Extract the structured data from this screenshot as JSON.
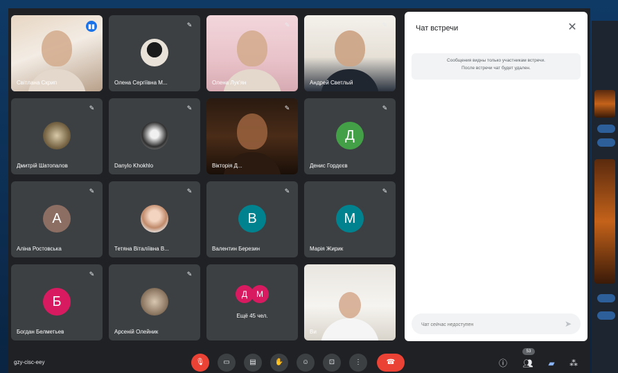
{
  "meeting": {
    "code": "gzy-cisc-eey",
    "participants_badge": "53"
  },
  "tiles": [
    {
      "name": "Світлана Скрип",
      "type": "video",
      "mic": "speaking",
      "active": true
    },
    {
      "name": "Олена Сергіївна М...",
      "type": "photo",
      "mic": "muted"
    },
    {
      "name": "Олена Лук'ян",
      "type": "video",
      "mic": "muted"
    },
    {
      "name": "Андрей Светлый",
      "type": "video",
      "mic": "muted"
    },
    {
      "name": "Дмитрій Шатопалов",
      "type": "photo",
      "mic": "muted"
    },
    {
      "name": "Danylo Khokhlo",
      "type": "photo",
      "mic": "muted"
    },
    {
      "name": "Вікторія Д...",
      "type": "video",
      "mic": "muted"
    },
    {
      "name": "Денис Гордєєв",
      "type": "avatar",
      "letter": "Д",
      "color": "#43a047",
      "mic": "muted"
    },
    {
      "name": "Аліна Ростовська",
      "type": "avatar",
      "letter": "А",
      "color": "#8d6e63",
      "mic": "muted"
    },
    {
      "name": "Тетяна Віталіївна В...",
      "type": "photo",
      "mic": "muted"
    },
    {
      "name": "Валентин Березин",
      "type": "avatar",
      "letter": "В",
      "color": "#00838f",
      "mic": "muted"
    },
    {
      "name": "Марія Жирик",
      "type": "avatar",
      "letter": "М",
      "color": "#00838f",
      "mic": "muted"
    },
    {
      "name": "Богдан Белметьев",
      "type": "avatar",
      "letter": "Б",
      "color": "#d81b60",
      "mic": "muted"
    },
    {
      "name": "Арсеній Олейник",
      "type": "photo",
      "mic": "muted"
    },
    {
      "name": "Ещё 45 чел.",
      "type": "more",
      "letters": [
        "Д",
        "М"
      ]
    },
    {
      "name": "Ви",
      "type": "video",
      "mic": "none"
    }
  ],
  "chat": {
    "title": "Чат встречи",
    "notice_line1": "Сообщения видны только участникам встречи.",
    "notice_line2": "После встречи чат будет удален.",
    "input_placeholder": "Чат сейчас недоступен"
  },
  "icons": {
    "mic_off": "mic-off-icon",
    "camera": "camera-icon",
    "captions": "captions-icon",
    "raise_hand": "hand-icon",
    "emoji": "emoji-icon",
    "present": "present-icon",
    "more": "more-vert-icon",
    "end_call": "call-end-icon",
    "info": "info-icon",
    "people": "people-icon",
    "chat": "chat-icon",
    "activities": "activities-icon"
  },
  "colors": {
    "accent": "#1a73e8",
    "danger": "#ea4335",
    "tile_bg": "#3c4043",
    "meeting_bg": "#202124"
  }
}
